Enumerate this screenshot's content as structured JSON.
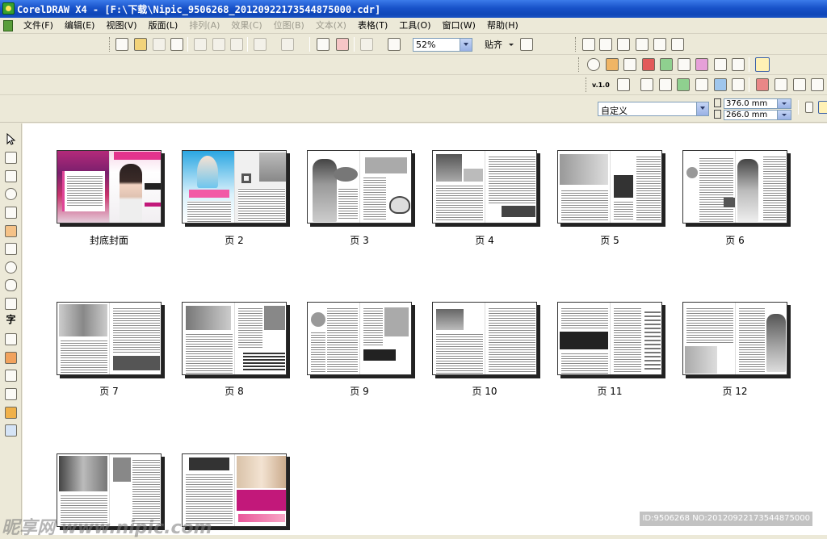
{
  "window": {
    "title": "CorelDRAW X4 - [F:\\下载\\Nipic_9506268_20120922173544875000.cdr]"
  },
  "menu": {
    "items": [
      {
        "label": "文件(F)",
        "enabled": true
      },
      {
        "label": "编辑(E)",
        "enabled": true
      },
      {
        "label": "视图(V)",
        "enabled": true
      },
      {
        "label": "版面(L)",
        "enabled": true
      },
      {
        "label": "排列(A)",
        "enabled": false
      },
      {
        "label": "效果(C)",
        "enabled": false
      },
      {
        "label": "位图(B)",
        "enabled": false
      },
      {
        "label": "文本(X)",
        "enabled": false
      },
      {
        "label": "表格(T)",
        "enabled": true
      },
      {
        "label": "工具(O)",
        "enabled": true
      },
      {
        "label": "窗口(W)",
        "enabled": true
      },
      {
        "label": "帮助(H)",
        "enabled": true
      }
    ]
  },
  "toolbar": {
    "zoom_level": "52%",
    "snap_label": "贴齐",
    "version_label": "v.1.0"
  },
  "property_bar": {
    "page_size": "自定义",
    "width": "376.0 mm",
    "height": "266.0 mm"
  },
  "toolbox": {
    "text_tool_glyph": "字"
  },
  "page_sorter": {
    "pages": [
      {
        "label": "封底封面",
        "style": "cover"
      },
      {
        "label": "页 2",
        "style": "blue"
      },
      {
        "label": "页 3",
        "style": "gray"
      },
      {
        "label": "页 4",
        "style": "gray"
      },
      {
        "label": "页 5",
        "style": "gray"
      },
      {
        "label": "页 6",
        "style": "gray"
      },
      {
        "label": "页 7",
        "style": "gray"
      },
      {
        "label": "页 8",
        "style": "gray"
      },
      {
        "label": "页 9",
        "style": "gray"
      },
      {
        "label": "页 10",
        "style": "gray"
      },
      {
        "label": "页 11",
        "style": "gray"
      },
      {
        "label": "页 12",
        "style": "gray"
      },
      {
        "label": "",
        "style": "gray"
      },
      {
        "label": "",
        "style": "pink"
      }
    ]
  },
  "watermark": {
    "site": "昵享网 www.nipic.com",
    "id_text": "ID:9506268 NO:20120922173544875000"
  },
  "colors": {
    "titlebar": "#0f46b8",
    "cover_accent": "#c2187a",
    "page2_accent": "#31a8e0"
  }
}
